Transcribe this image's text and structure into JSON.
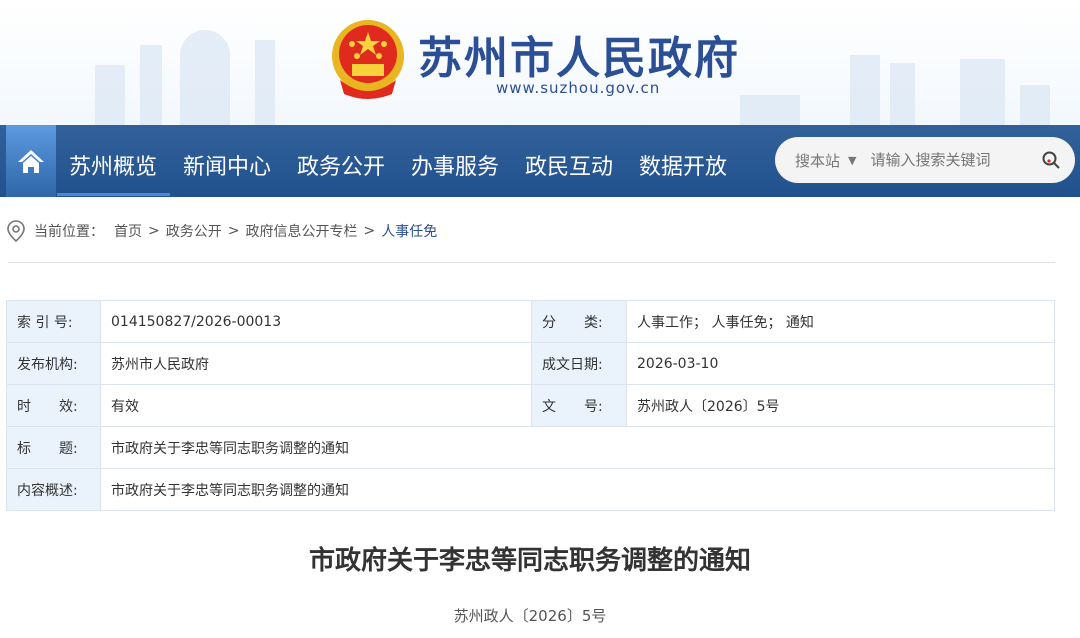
{
  "header": {
    "title": "苏州市人民政府",
    "url": "www.suzhou.gov.cn"
  },
  "nav": {
    "items": [
      "苏州概览",
      "新闻中心",
      "政务公开",
      "办事服务",
      "政民互动",
      "数据开放"
    ]
  },
  "search": {
    "scope": "搜本站",
    "placeholder": "请输入搜索关键词"
  },
  "breadcrumb": {
    "label": "当前位置：",
    "items": [
      "首页",
      "政务公开",
      "政府信息公开专栏",
      "人事任免"
    ],
    "sep": ">"
  },
  "meta": {
    "index_label": "索 引 号:",
    "index": "014150827/2026-00013",
    "category_label": "分　　类:",
    "category": "人事工作； 人事任免； 通知",
    "publisher_label": "发布机构:",
    "publisher": "苏州市人民政府",
    "date_label": "成文日期:",
    "date": "2026-03-10",
    "validity_label": "时　　效:",
    "validity": "有效",
    "docno_label": "文　　号:",
    "docno": "苏州政人〔2026〕5号",
    "title_label": "标　　题:",
    "title": "市政府关于李忠等同志职务调整的通知",
    "summary_label": "内容概述:",
    "summary": "市政府关于李忠等同志职务调整的通知"
  },
  "article": {
    "title": "市政府关于李忠等同志职务调整的通知",
    "doc_no": "苏州政人〔2026〕5号"
  },
  "colors": {
    "nav": "#2a5592",
    "brand": "#2b4f94",
    "label_bg": "#eaf3fc"
  }
}
